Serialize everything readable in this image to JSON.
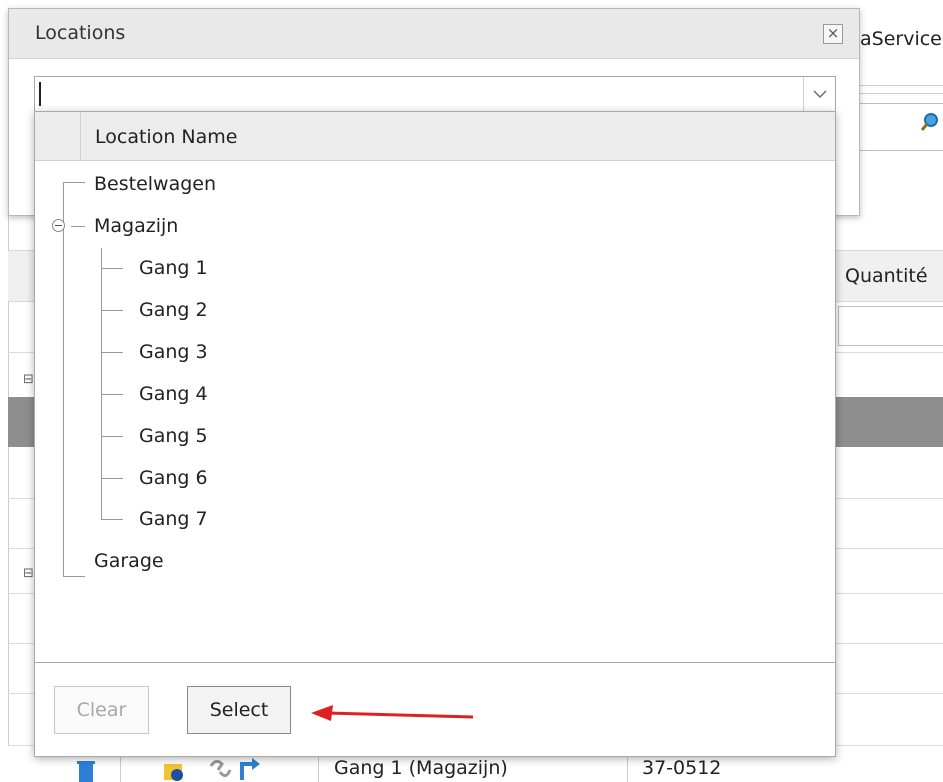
{
  "background": {
    "service_text": "aService",
    "quantity_header": "Quantité",
    "bottom_row": {
      "location": "Gang 1 (Magazijn)",
      "code": "37-0512"
    }
  },
  "dialog": {
    "title": "Locations",
    "close_glyph": "×",
    "combo": {
      "value": "",
      "arrow_icon": "chevron-down-icon"
    },
    "dropdown": {
      "column_header": "Location Name",
      "tree": [
        {
          "label": "Bestelwagen"
        },
        {
          "label": "Magazijn",
          "expanded": true,
          "children": [
            {
              "label": "Gang 1"
            },
            {
              "label": "Gang 2"
            },
            {
              "label": "Gang 3"
            },
            {
              "label": "Gang 4"
            },
            {
              "label": "Gang 5"
            },
            {
              "label": "Gang 6"
            },
            {
              "label": "Gang 7"
            }
          ]
        },
        {
          "label": "Garage"
        }
      ]
    },
    "buttons": {
      "clear": "Clear",
      "select": "Select"
    }
  },
  "annotation": {
    "arrow_color": "#e02020"
  }
}
